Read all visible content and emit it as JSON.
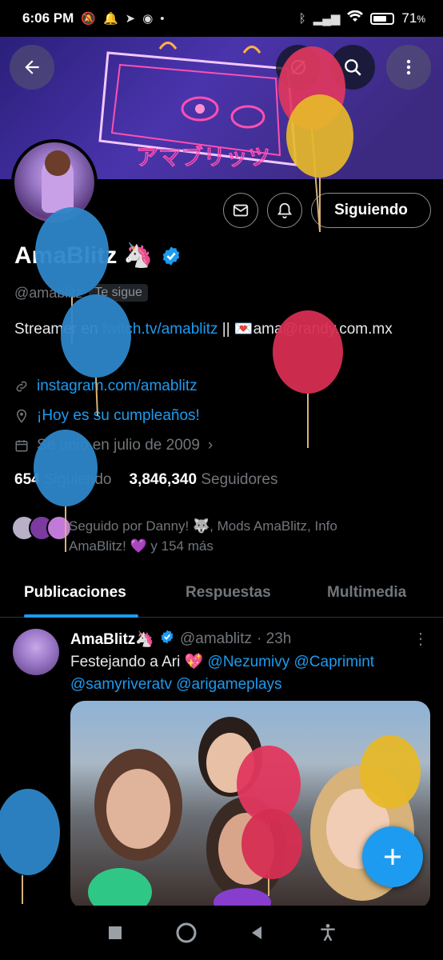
{
  "status_bar": {
    "time": "6:06 PM",
    "battery": "71",
    "battery_unit": "%",
    "battery_level": 0.71
  },
  "banner": {
    "art_text": "アマブリッツ"
  },
  "profile": {
    "name": "AmaBlitz",
    "name_emoji": "🦄",
    "handle": "@amablitz",
    "follows_you": "Te sigue",
    "bio_prefix": "Streamer en ",
    "bio_link": "twitch.tv/amablitz",
    "bio_mid": " || ",
    "bio_heart": "💌",
    "bio_suffix": "ama@randy.com.mx",
    "website": "instagram.com/amablitz",
    "birthday": "¡Hoy es su cumpleaños!",
    "joined": "Se unió en julio de 2009",
    "following_count": "654",
    "following_label": "Siguiendo",
    "followers_count": "3,846,340",
    "followers_label": "Seguidores",
    "followed_by": "Seguido por Danny! 🐺, Mods AmaBlitz, Info AmaBlitz! 💜 y 154 más"
  },
  "actions": {
    "follow_label": "Siguiendo"
  },
  "tabs": [
    {
      "label": "Publicaciones",
      "active": true
    },
    {
      "label": "Respuestas",
      "active": false
    },
    {
      "label": "Multimedia",
      "active": false
    }
  ],
  "post": {
    "author": "AmaBlitz",
    "author_emoji": "🦄",
    "handle": "@amablitz",
    "time": "· 23h",
    "text_prefix": "Festejando a Ari 💖 ",
    "mentions": "@Nezumivy @Caprimint @samyriveratv @arigameplays"
  },
  "icons": {
    "back": "back-arrow-icon",
    "link": "link-icon",
    "location": "location-pin-icon",
    "calendar": "calendar-icon",
    "mail": "envelope-icon",
    "bell": "bell-icon",
    "search": "search-icon",
    "more": "more-vertical-icon",
    "compose": "plus-icon"
  },
  "colors": {
    "accent": "#1d9bf0",
    "background": "#000000",
    "muted_text": "#71767b"
  }
}
